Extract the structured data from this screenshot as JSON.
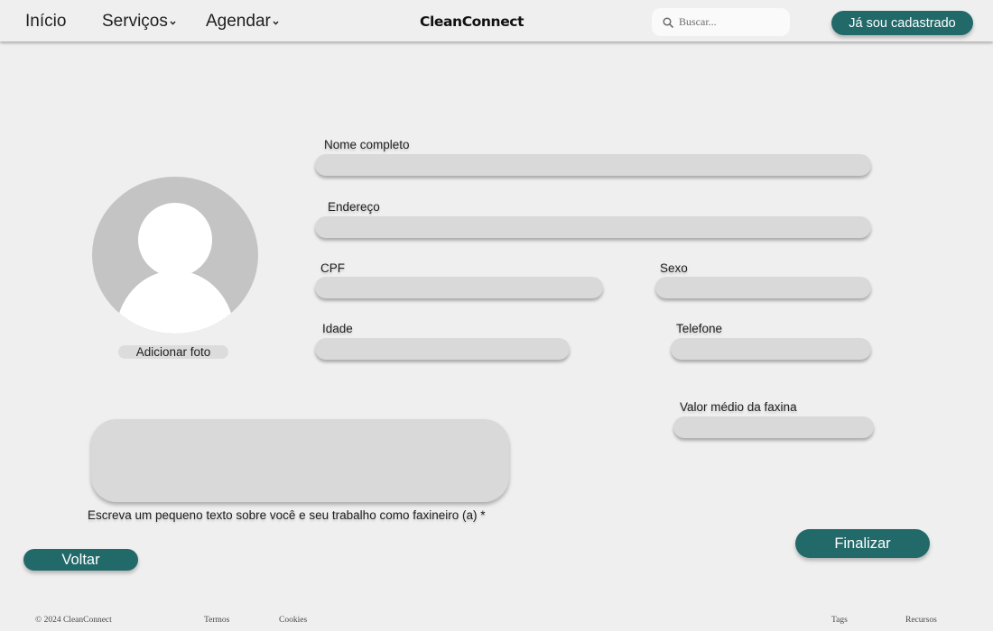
{
  "header": {
    "nav": [
      {
        "label": "Início",
        "has_dropdown": false
      },
      {
        "label": "Serviços",
        "has_dropdown": true
      },
      {
        "label": "Agendar",
        "has_dropdown": true
      }
    ],
    "brand": "CleanConnect",
    "search": {
      "placeholder": "Buscar...",
      "value": "",
      "icon": "search-icon"
    },
    "login_button": "Já sou cadastrado"
  },
  "profile": {
    "avatar_icon": "user-placeholder-icon",
    "add_photo_label": "Adicionar foto"
  },
  "form": {
    "fields": {
      "full_name": {
        "label": "Nome completo",
        "value": ""
      },
      "address": {
        "label": "Endereço",
        "value": ""
      },
      "cpf": {
        "label": "CPF",
        "value": ""
      },
      "sex": {
        "label": "Sexo",
        "value": ""
      },
      "age": {
        "label": "Idade",
        "value": ""
      },
      "phone": {
        "label": "Telefone",
        "value": ""
      },
      "avg_price": {
        "label": "Valor médio da faxina",
        "value": ""
      }
    },
    "bio": {
      "label": "Escreva um pequeno texto sobre você e seu trabalho como faxineiro (a) *",
      "value": ""
    },
    "finish_button": "Finalizar",
    "back_button": "Voltar"
  },
  "footer": {
    "copyright": "© 2024 CleanConnect",
    "links": [
      "Termos",
      "Cookies",
      "Tags",
      "Recursos"
    ]
  },
  "colors": {
    "accent": "#22696a",
    "background": "#efefef",
    "field": "#d9d9d9",
    "avatar_bg": "#c4c4c4"
  }
}
